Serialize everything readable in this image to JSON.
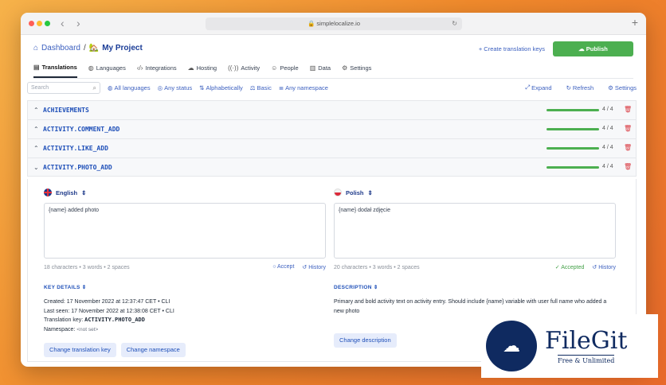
{
  "browser": {
    "url": "simplelocalize.io"
  },
  "header": {
    "dashboard_label": "Dashboard",
    "separator": "/",
    "project_label": "My Project",
    "create_keys_label": "+ Create translation keys",
    "publish_label": "Publish"
  },
  "tabs": [
    {
      "label": "Translations",
      "icon": "translations-icon",
      "active": true
    },
    {
      "label": "Languages",
      "icon": "globe-icon"
    },
    {
      "label": "Integrations",
      "icon": "code-icon"
    },
    {
      "label": "Hosting",
      "icon": "cloud-icon"
    },
    {
      "label": "Activity",
      "icon": "activity-icon"
    },
    {
      "label": "People",
      "icon": "people-icon"
    },
    {
      "label": "Data",
      "icon": "database-icon"
    },
    {
      "label": "Settings",
      "icon": "gear-icon"
    }
  ],
  "filters": {
    "search_placeholder": "Search",
    "all_languages": "All languages",
    "any_status": "Any status",
    "alphabetically": "Alphabetically",
    "basic": "Basic",
    "any_namespace": "Any namespace",
    "expand": "Expand",
    "refresh": "Refresh",
    "settings": "Settings"
  },
  "keys": [
    {
      "name": "ACHIEVEMENTS",
      "count": "4 / 4",
      "progress": 1.0
    },
    {
      "name": "ACTIVITY.COMMENT_ADD",
      "count": "4 / 4",
      "progress": 1.0
    },
    {
      "name": "ACTIVITY.LIKE_ADD",
      "count": "4 / 4",
      "progress": 1.0
    },
    {
      "name": "ACTIVITY.PHOTO_ADD",
      "count": "4 / 4",
      "progress": 1.0
    }
  ],
  "editor": {
    "english": {
      "language": "English",
      "text": "{name} added photo",
      "stats": "18 characters • 3 words • 2 spaces",
      "accept_label": "Accept",
      "history_label": "History"
    },
    "polish": {
      "language": "Polish",
      "text": "{name} dodał zdjęcie",
      "stats": "20 characters • 3 words • 2 spaces",
      "accepted_label": "Accepted",
      "history_label": "History"
    },
    "key_details": {
      "title": "KEY DETAILS",
      "created": "Created: 17 November 2022 at 12:37:47 CET • CLI",
      "last_seen": "Last seen: 17 November 2022 at 12:38:08 CET • CLI",
      "translation_key_label": "Translation key:",
      "translation_key_value": "ACTIVITY.PHOTO_ADD",
      "namespace_label": "Namespace:",
      "namespace_value": "<not set>",
      "change_key_button": "Change translation key",
      "change_namespace_button": "Change namespace"
    },
    "description": {
      "title": "DESCRIPTION",
      "text": "Primary and bold activity text on activity entry. Should include {name} variable with user full name who added a new photo",
      "change_button": "Change description"
    }
  },
  "watermark": {
    "name": "FileGit",
    "tagline": "Free & Unlimited"
  },
  "colors": {
    "accent": "#3b5fbf",
    "publish_green": "#4caf50",
    "delete_red": "#d9363e"
  }
}
